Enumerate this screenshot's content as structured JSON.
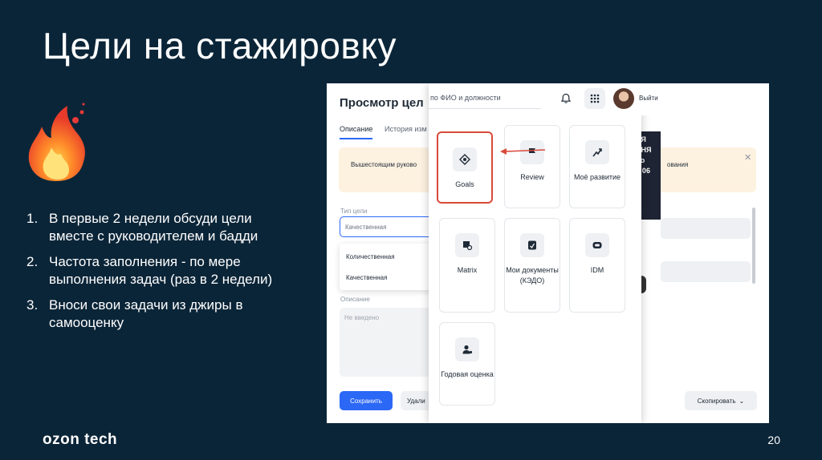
{
  "slide": {
    "title": "Цели на стажировку",
    "page_number": "20",
    "logo": "ozon tech",
    "steps": [
      {
        "num": "1.",
        "text": "В первые 2 недели обсуди цели вместе с руководителем и бадди"
      },
      {
        "num": "2.",
        "text": "Частота заполнения - по мере выполнения задач (раз в 2 недели)"
      },
      {
        "num": "3.",
        "text": "Вноси свои задачи из джиры в самооценку"
      }
    ]
  },
  "screenshot": {
    "background_page": {
      "title": "Просмотр цел",
      "tabs": [
        "Описание",
        "История изм"
      ],
      "note_text": "Вышестоящим руково",
      "note_text_right": "ования",
      "goal_type_label": "Тип цели",
      "goal_type_value": "Качественная",
      "dropdown_options": [
        "Количественная",
        "Качественная"
      ],
      "description_label": "Описание",
      "description_placeholder": "Не введено",
      "save_button": "Сохранить",
      "delete_button": "Удали",
      "copy_button": "Скопировать",
      "banner_text": "ЛЯ\nЯНЯ\nдо\nн 06",
      "banner_bottom": "ON"
    },
    "top_bar": {
      "search_placeholder": "по ФИО и должности",
      "user_action": "Выйти"
    },
    "apps": [
      {
        "label": "Goals",
        "icon": "target-icon",
        "highlighted": true
      },
      {
        "label": "Review",
        "icon": "flag-icon",
        "highlighted": false
      },
      {
        "label": "Моё развитие",
        "icon": "growth-icon",
        "highlighted": false
      },
      {
        "label": "Matrix",
        "icon": "matrix-search-icon",
        "highlighted": false
      },
      {
        "label": "Мои документы (КЭДО)",
        "icon": "document-icon",
        "highlighted": false
      },
      {
        "label": "IDM",
        "icon": "idm-icon",
        "highlighted": false
      },
      {
        "label": "Годовая оценка",
        "icon": "user-star-icon",
        "highlighted": false
      }
    ],
    "colors": {
      "accent": "#2c68f6",
      "highlight": "#d94a3a",
      "slide_bg": "#0b2538"
    }
  }
}
